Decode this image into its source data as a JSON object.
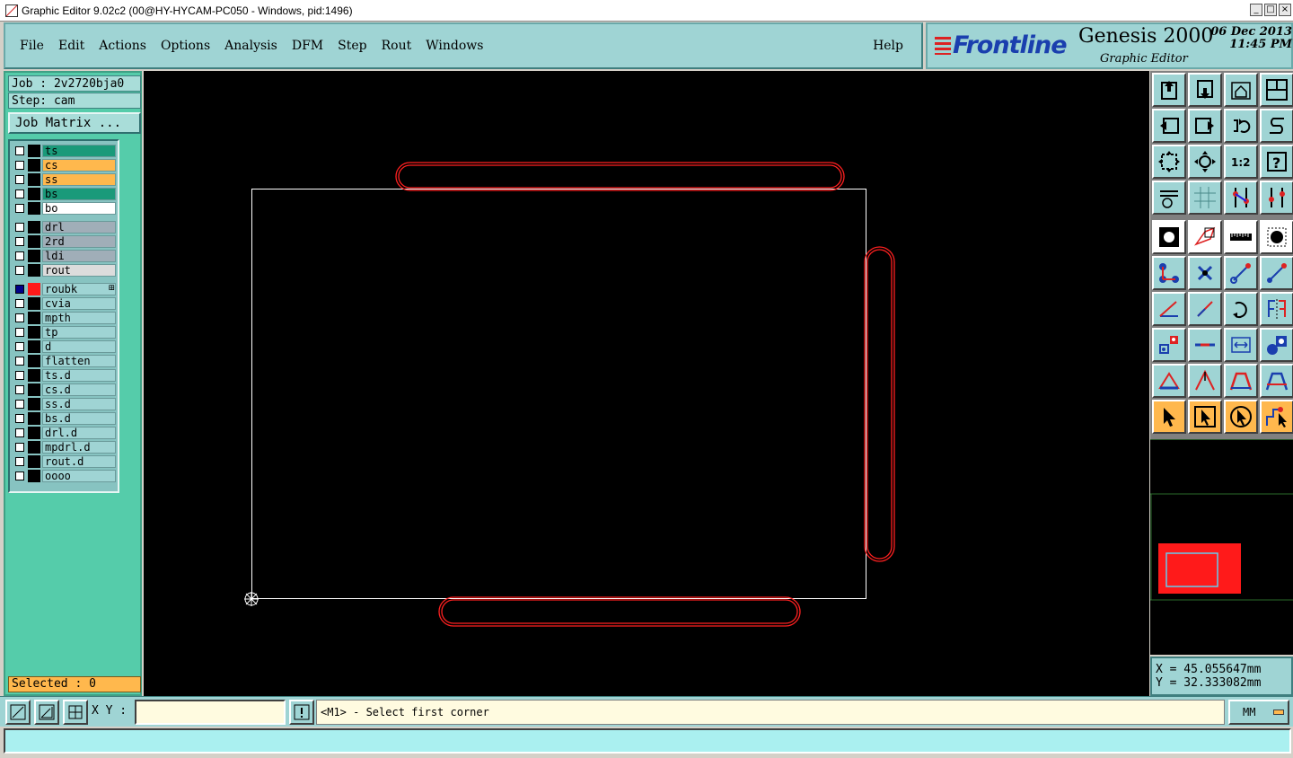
{
  "window": {
    "title": "Graphic Editor 9.02c2 (00@HY-HYCAM-PC050 - Windows, pid:1496)"
  },
  "menu": {
    "items": [
      {
        "id": "file",
        "label": "File"
      },
      {
        "id": "edit",
        "label": "Edit"
      },
      {
        "id": "actions",
        "label": "Actions"
      },
      {
        "id": "options",
        "label": "Options"
      },
      {
        "id": "analysis",
        "label": "Analysis"
      },
      {
        "id": "dfm",
        "label": "DFM"
      },
      {
        "id": "step",
        "label": "Step"
      },
      {
        "id": "rout",
        "label": "Rout"
      },
      {
        "id": "windows",
        "label": "Windows"
      }
    ],
    "help": "Help"
  },
  "brand": {
    "logo": "Frontline",
    "product": "Genesis 2000",
    "subtitle": "Graphic Editor",
    "date": "06 Dec 2013",
    "time": "11:45 PM"
  },
  "job": {
    "job_line": "Job : 2v2720bja0",
    "step_line": "Step: cam",
    "matrix_button": "Job Matrix ..."
  },
  "layers": [
    {
      "name": "ts",
      "bg": "#1a9a7a",
      "checked": false,
      "color": "#000000"
    },
    {
      "name": "cs",
      "bg": "#ffb84d",
      "checked": false,
      "color": "#000000"
    },
    {
      "name": "ss",
      "bg": "#ffb84d",
      "checked": false,
      "color": "#000000"
    },
    {
      "name": "bs",
      "bg": "#1a9a7a",
      "checked": false,
      "color": "#000000"
    },
    {
      "name": "bo",
      "bg": "#ffffff",
      "checked": false,
      "color": "#000000"
    },
    {
      "name": "drl",
      "bg": "#a0aeb8",
      "checked": false,
      "color": "#000000"
    },
    {
      "name": "2rd",
      "bg": "#a0aeb8",
      "checked": false,
      "color": "#000000"
    },
    {
      "name": "ldi",
      "bg": "#a0aeb8",
      "checked": false,
      "color": "#000000"
    },
    {
      "name": "rout",
      "bg": "#dcdcdc",
      "checked": false,
      "color": "#000000"
    },
    {
      "name": "roubk",
      "bg": "#9fd4d4",
      "checked": true,
      "color": "#ff1a1a"
    },
    {
      "name": "cvia",
      "bg": "#9fd4d4",
      "checked": false,
      "color": "#000000"
    },
    {
      "name": "mpth",
      "bg": "#9fd4d4",
      "checked": false,
      "color": "#000000"
    },
    {
      "name": "tp",
      "bg": "#9fd4d4",
      "checked": false,
      "color": "#000000"
    },
    {
      "name": "d",
      "bg": "#9fd4d4",
      "checked": false,
      "color": "#000000"
    },
    {
      "name": "flatten",
      "bg": "#9fd4d4",
      "checked": false,
      "color": "#000000"
    },
    {
      "name": "ts.d",
      "bg": "#9fd4d4",
      "checked": false,
      "color": "#000000"
    },
    {
      "name": "cs.d",
      "bg": "#9fd4d4",
      "checked": false,
      "color": "#000000"
    },
    {
      "name": "ss.d",
      "bg": "#9fd4d4",
      "checked": false,
      "color": "#000000"
    },
    {
      "name": "bs.d",
      "bg": "#9fd4d4",
      "checked": false,
      "color": "#000000"
    },
    {
      "name": "drl.d",
      "bg": "#9fd4d4",
      "checked": false,
      "color": "#000000"
    },
    {
      "name": "mpdrl.d",
      "bg": "#9fd4d4",
      "checked": false,
      "color": "#000000"
    },
    {
      "name": "rout.d",
      "bg": "#9fd4d4",
      "checked": false,
      "color": "#000000"
    },
    {
      "name": "oooo",
      "bg": "#9fd4d4",
      "checked": false,
      "color": "#000000"
    }
  ],
  "selected": "Selected : 0",
  "coords": {
    "x_line": "X = 45.055647mm",
    "y_line": "Y = 32.333082mm"
  },
  "command": {
    "xy_label": "X Y :",
    "xy_value": "",
    "message": "<M1> - Select first corner",
    "units": "MM"
  },
  "tools": [
    {
      "name": "zoom-page-up-icon",
      "kind": "teal"
    },
    {
      "name": "zoom-page-down-icon",
      "kind": "teal"
    },
    {
      "name": "home-view-icon",
      "kind": "teal"
    },
    {
      "name": "split-view-icon",
      "kind": "teal"
    },
    {
      "name": "pan-left-icon",
      "kind": "teal"
    },
    {
      "name": "pan-right-icon",
      "kind": "teal"
    },
    {
      "name": "undo-view-icon",
      "kind": "teal"
    },
    {
      "name": "s-curve-icon",
      "kind": "teal"
    },
    {
      "name": "zoom-fit-icon",
      "kind": "teal"
    },
    {
      "name": "zoom-center-icon",
      "kind": "teal"
    },
    {
      "name": "scale-1-2-icon",
      "kind": "teal"
    },
    {
      "name": "query-icon",
      "kind": "teal"
    },
    {
      "name": "settings-palette-icon",
      "kind": "teal"
    },
    {
      "name": "grid-icon",
      "kind": "teal"
    },
    {
      "name": "snap-on-icon",
      "kind": "teal"
    },
    {
      "name": "snap-off-icon",
      "kind": "teal"
    },
    {
      "name": "pad-icon",
      "kind": "white"
    },
    {
      "name": "surface-icon",
      "kind": "white"
    },
    {
      "name": "ruler-icon",
      "kind": "white"
    },
    {
      "name": "circle-pad-icon",
      "kind": "white"
    },
    {
      "name": "connect-points-icon",
      "kind": "teal"
    },
    {
      "name": "delete-cross-icon",
      "kind": "teal"
    },
    {
      "name": "line-add-icon",
      "kind": "teal"
    },
    {
      "name": "line-extend-icon",
      "kind": "teal"
    },
    {
      "name": "angle-line-icon",
      "kind": "teal"
    },
    {
      "name": "slant-line-icon",
      "kind": "teal"
    },
    {
      "name": "arc-icon",
      "kind": "teal"
    },
    {
      "name": "mirror-icon",
      "kind": "teal"
    },
    {
      "name": "pad-move-icon",
      "kind": "teal"
    },
    {
      "name": "line-segment-icon",
      "kind": "teal"
    },
    {
      "name": "measure-icon",
      "kind": "teal"
    },
    {
      "name": "shapes-icon",
      "kind": "teal"
    },
    {
      "name": "triangle-fill-icon",
      "kind": "teal"
    },
    {
      "name": "peak-icon",
      "kind": "teal"
    },
    {
      "name": "trapezoid-icon",
      "kind": "teal"
    },
    {
      "name": "trapezoid-blue-icon",
      "kind": "teal"
    },
    {
      "name": "pointer-icon",
      "kind": "yellow"
    },
    {
      "name": "pointer-box-icon",
      "kind": "yellow"
    },
    {
      "name": "pointer-circle-icon",
      "kind": "yellow"
    },
    {
      "name": "pointer-path-icon",
      "kind": "yellow"
    }
  ]
}
